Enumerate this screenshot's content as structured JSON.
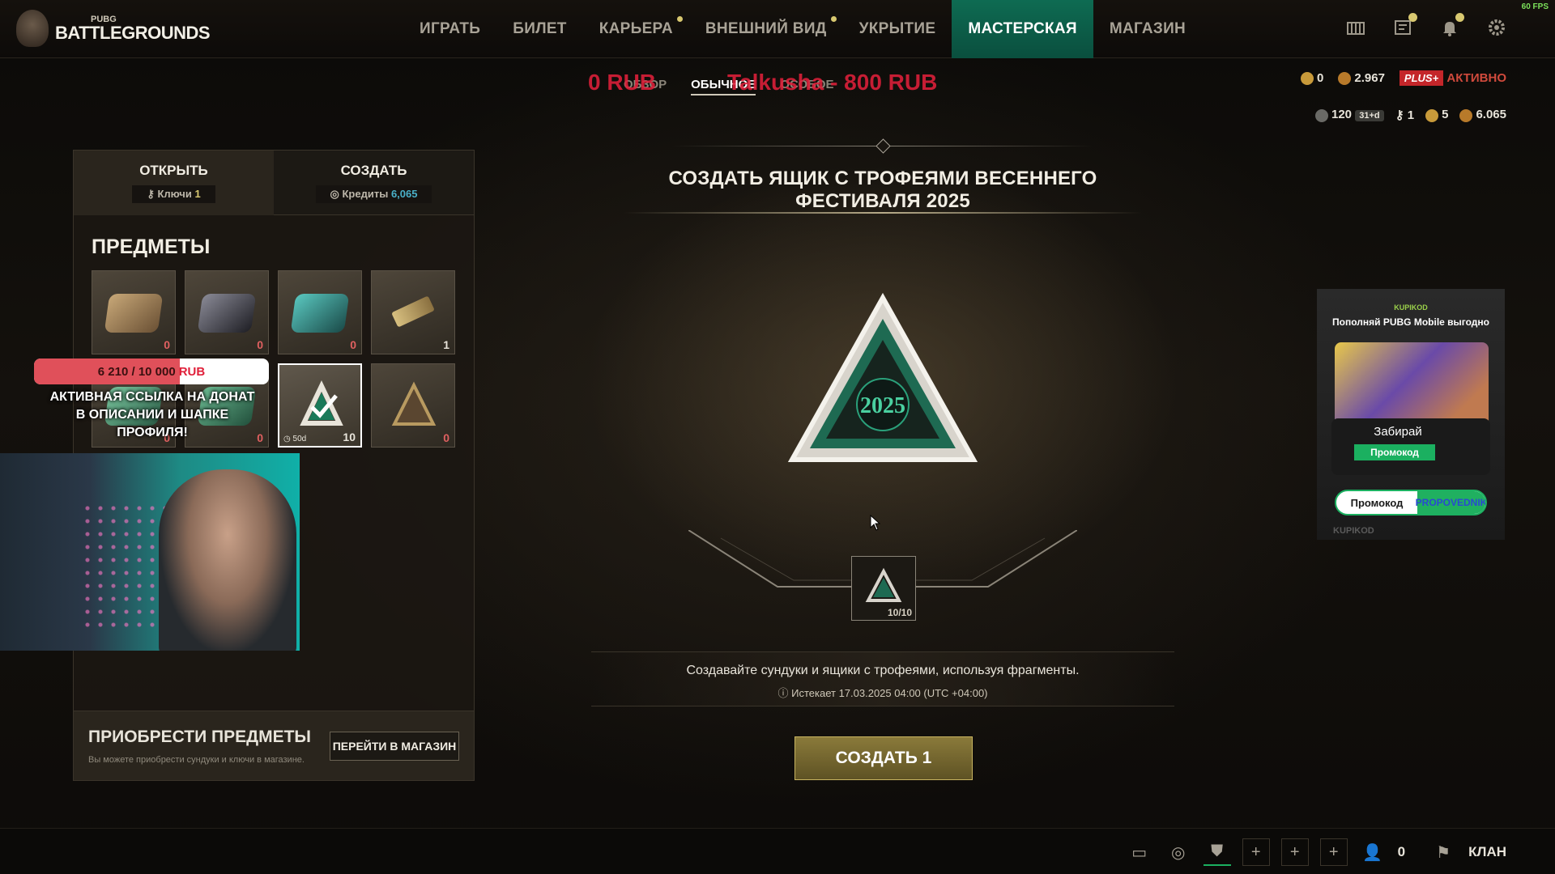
{
  "fps": "60 FPS",
  "logo": {
    "small": "PUBG",
    "big": "BATTLEGROUNDS"
  },
  "nav": [
    {
      "label": "ИГРАТЬ",
      "dot": false,
      "active": false
    },
    {
      "label": "БИЛЕТ",
      "dot": false,
      "active": false
    },
    {
      "label": "КАРЬЕРА",
      "dot": true,
      "active": false
    },
    {
      "label": "ВНЕШНИЙ ВИД",
      "dot": true,
      "active": false
    },
    {
      "label": "УКРЫТИЕ",
      "dot": false,
      "active": false
    },
    {
      "label": "МАСТЕРСКАЯ",
      "dot": false,
      "active": true
    },
    {
      "label": "МАГАЗИН",
      "dot": false,
      "active": false
    }
  ],
  "top_icons": [
    "shop-icon",
    "news-icon",
    "bell-icon",
    "gear-icon"
  ],
  "currency": {
    "g_coin": "0",
    "bp": "2.967",
    "plus": "PLUS+",
    "plus_status": "АКТИВНО",
    "row2_a": "120",
    "row2_timer": "31+d",
    "keys": "1",
    "fragments": "5",
    "credits": "6.065"
  },
  "subtabs": [
    "ОБЗОР",
    "ОБЫЧНОЕ",
    "ОСОБОЕ"
  ],
  "subtab_active": 1,
  "stream_overlay": {
    "red_left": "0 RUB",
    "red_mid": "Talkusha - 800 RUB"
  },
  "left_panel": {
    "tab_open": "ОТКРЫТЬ",
    "tab_open_sub_label": "Ключи",
    "tab_open_sub_value": "1",
    "tab_create": "СОЗДАТЬ",
    "tab_create_sub_label": "Кредиты",
    "tab_create_sub_value": "6,065",
    "items_heading": "ПРЕДМЕТЫ",
    "items": [
      {
        "name": "bronze-crate",
        "count": "0",
        "color": "#9a7a54"
      },
      {
        "name": "dark-crate",
        "count": "0",
        "color": "#3a3a42"
      },
      {
        "name": "teal-crate",
        "count": "0",
        "color": "#2a8a88"
      },
      {
        "name": "key-item",
        "count": "1",
        "color": "#b8a060"
      },
      {
        "name": "green-crate-a",
        "count": "0",
        "color": "#3a8a6a"
      },
      {
        "name": "green-crate-b",
        "count": "0",
        "color": "#3a7a5a"
      },
      {
        "name": "fragment-2025",
        "count": "10",
        "timer": "50d",
        "color": "#2aa07a"
      },
      {
        "name": "gold-triangle",
        "count": "0",
        "color": "#8a6a3a"
      }
    ],
    "buy_title": "ПРИОБРЕСТИ ПРЕДМЕТЫ",
    "buy_desc": "Вы можете приобрести сундуки и ключи в магазине.",
    "shop_button": "ПЕРЕЙТИ В МАГАЗИН"
  },
  "donation": {
    "progress_text": "6 210 / 10 000",
    "currency": "RUB",
    "progress_fraction": 0.621,
    "caption": "АКТИВНАЯ ССЫЛКА НА ДОНАТ В ОПИСАНИИ И ШАПКЕ ПРОФИЛЯ!"
  },
  "center": {
    "title": "СОЗДАТЬ ЯЩИК С ТРОФЕЯМИ ВЕСЕННЕГО ФЕСТИВАЛЯ 2025",
    "crate_year": "2025",
    "slot_count": "10/10",
    "info": "Создавайте сундуки и ящики с трофеями, используя фрагменты.",
    "expire": "Истекает 17.03.2025 04:00 (UTC +04:00)",
    "create_button": "СОЗДАТЬ 1"
  },
  "ad": {
    "brand": "KUPIKOD",
    "head": "Пополняй PUBG Mobile выгодно",
    "take": "Забирай",
    "promo_small": "Промокод",
    "pill_left": "Промокод",
    "pill_right": "PROPOVEDNIK",
    "foot": "KUPIKOD"
  },
  "bottom": {
    "friends": "0",
    "clan": "КЛАН"
  },
  "colors": {
    "accent_green": "#0e6b52",
    "create_gold": "#8a7a3a",
    "alert_yellow": "#d8c870"
  }
}
